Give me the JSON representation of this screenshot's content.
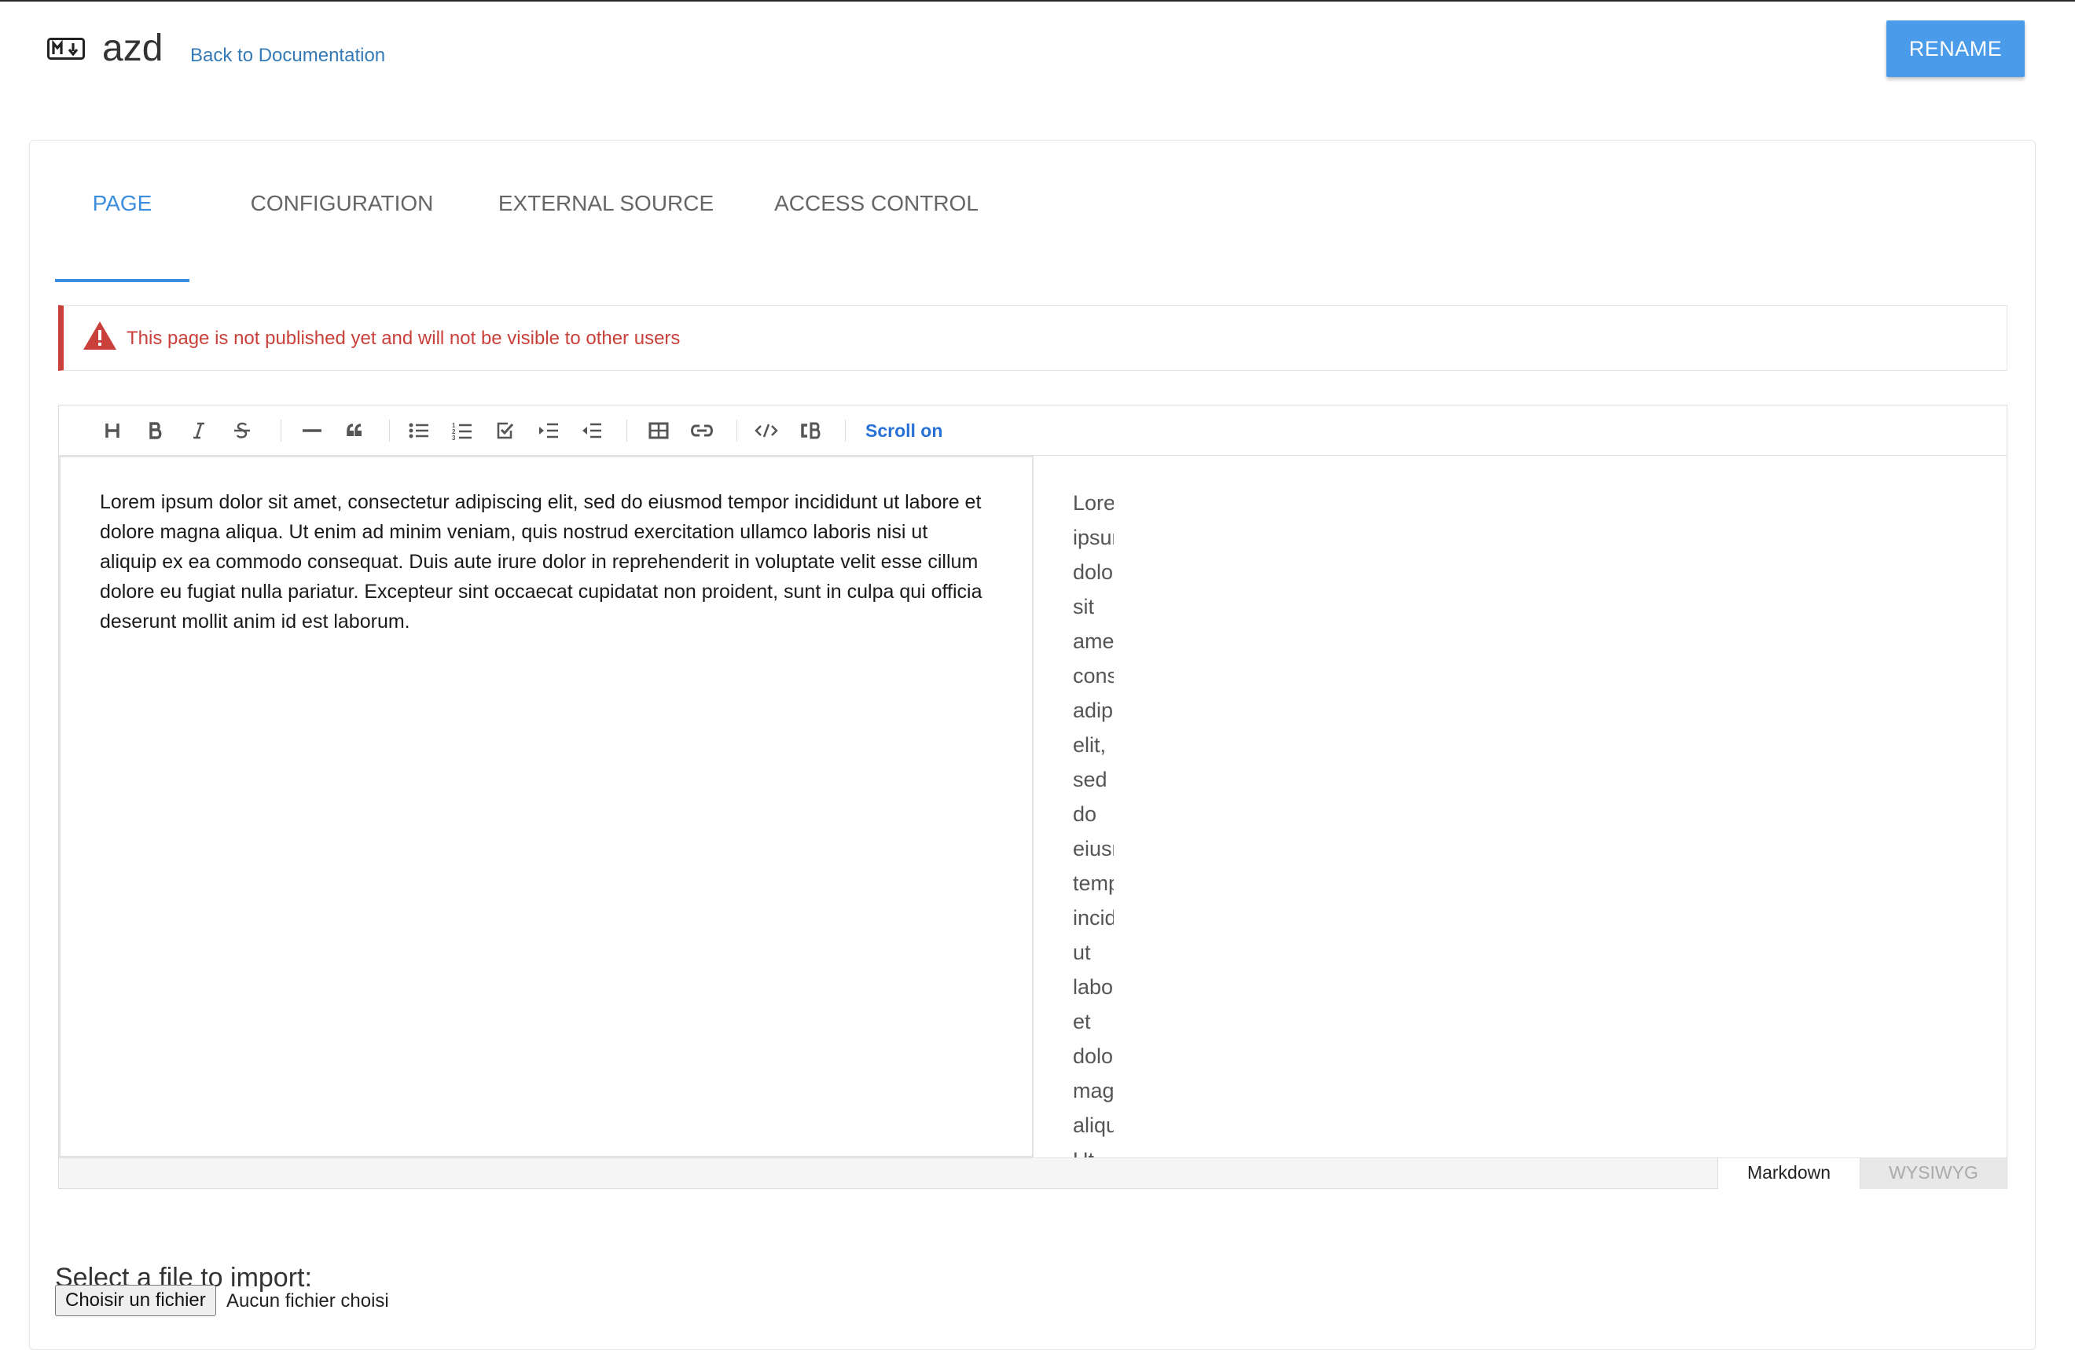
{
  "header": {
    "logo_icon": "markdown-logo-icon",
    "title": "azd",
    "back_link": "Back to Documentation",
    "rename_label": "RENAME",
    "accent_color": "#4a9cea"
  },
  "tabs": [
    {
      "label": "PAGE",
      "active": true
    },
    {
      "label": "CONFIGURATION",
      "active": false
    },
    {
      "label": "EXTERNAL SOURCE",
      "active": false
    },
    {
      "label": "ACCESS CONTROL",
      "active": false
    }
  ],
  "alert": {
    "icon": "warning-triangle-icon",
    "text": "This page is not published yet and will not be visible to other users",
    "color": "#c9413a"
  },
  "toolbar": {
    "buttons": [
      "heading-icon",
      "bold-icon",
      "italic-icon",
      "strikethrough-icon",
      "horizontal-rule-icon",
      "quote-icon",
      "bullet-list-icon",
      "ordered-list-icon",
      "task-list-icon",
      "indent-icon",
      "outdent-icon",
      "table-icon",
      "link-icon",
      "code-icon",
      "code-block-icon"
    ],
    "scroll_toggle": "Scroll on"
  },
  "editor": {
    "markdown_text": "Lorem ipsum dolor sit amet, consectetur adipiscing elit, sed do eiusmod tempor incididunt ut labore et dolore magna aliqua. Ut enim ad minim veniam, quis nostrud exercitation ullamco laboris nisi ut aliquip ex ea commodo consequat. Duis aute irure dolor in reprehenderit in voluptate velit esse cillum dolore eu fugiat nulla pariatur. Excepteur sint occaecat cupidatat non proident, sunt in culpa qui officia deserunt mollit anim id est laborum.",
    "preview_text": "Lorem ipsum dolor sit amet, consectetur adipiscing elit, sed do eiusmod tempor incididunt ut labore et dolore magna aliqua. Ut",
    "mode_markdown": "Markdown",
    "mode_wysiwyg": "WYSIWYG"
  },
  "import": {
    "title": "Select a file to import:",
    "button_label": "Choisir un fichier",
    "status": "Aucun fichier choisi"
  }
}
